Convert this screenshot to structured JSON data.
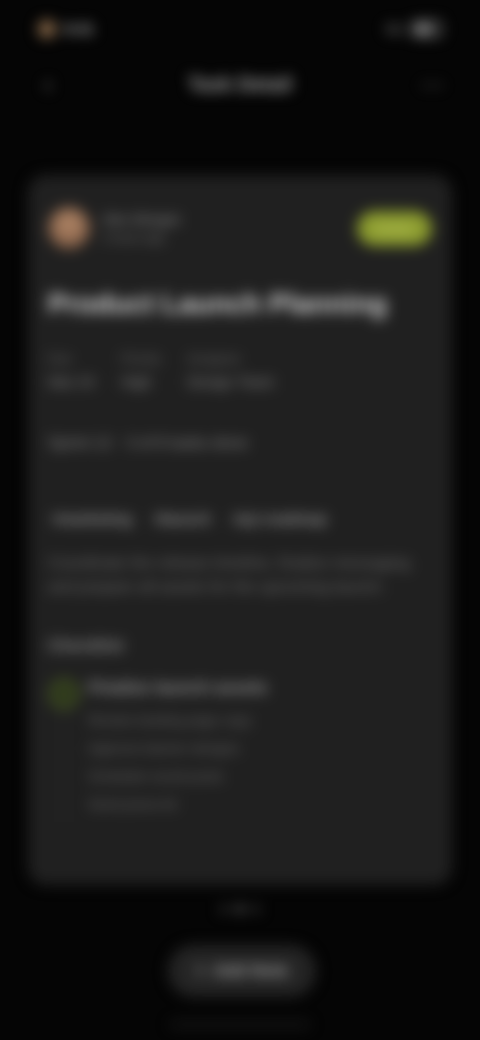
{
  "status_bar": {
    "time": "9:41",
    "network": "5G"
  },
  "top_nav": {
    "back_icon": "chevron-left-icon",
    "title": "Task Detail",
    "menu_icon": "more-icon"
  },
  "card": {
    "author_name": "Alex Morgan",
    "author_meta": "2 hours ago",
    "status": "Active",
    "title": "Product Launch Planning",
    "meta": [
      {
        "label": "Due",
        "value": "Mar 24"
      },
      {
        "label": "Priority",
        "value": "High"
      },
      {
        "label": "Assignee",
        "value": "Design Team"
      }
    ],
    "info_line": "Sprint 12 · 3 of 8 tasks done",
    "tags": [
      "#marketing",
      "#launch",
      "#q1-roadmap"
    ],
    "description": "Coordinate the release timeline, finalize messaging and prepare all assets for the upcoming launch.",
    "section_title": "Checklist",
    "list_head": "Finalize launch assets",
    "list_items": [
      "Review landing page copy",
      "Approve banner designs",
      "Schedule social posts",
      "Send press kit"
    ]
  },
  "bottom_button_label": "Add Note",
  "colors": {
    "badge": "#8a9a2e",
    "card": "#202020",
    "background": "#050505"
  }
}
